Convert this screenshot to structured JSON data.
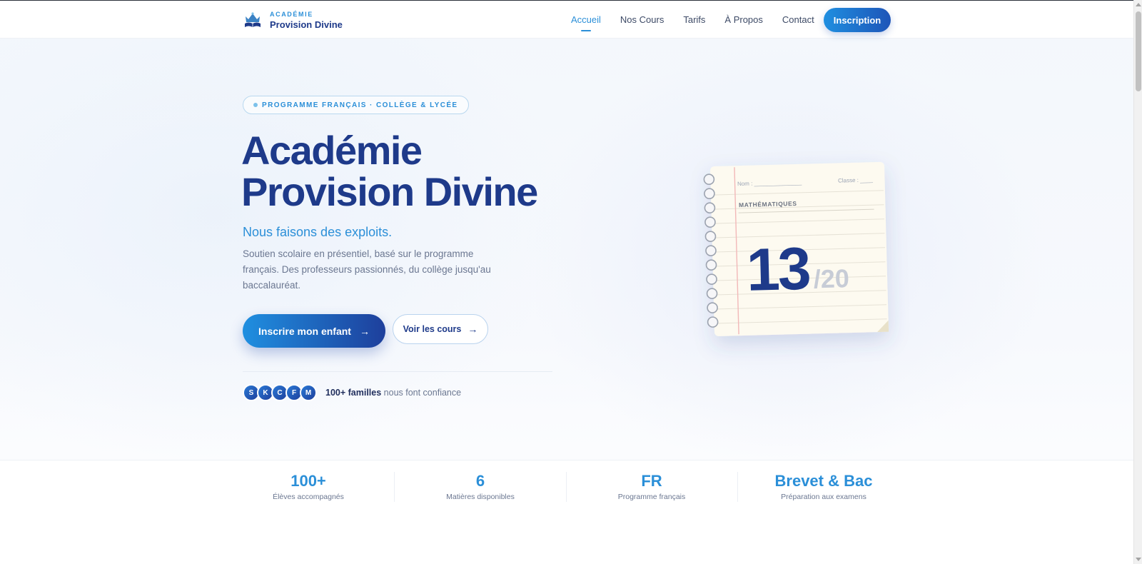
{
  "brand": {
    "top": "ACADÉMIE",
    "name": "Provision Divine",
    "logo_icon": "crown-book-logo"
  },
  "nav": {
    "links": [
      {
        "label": "Accueil",
        "active": true
      },
      {
        "label": "Nos Cours",
        "active": false
      },
      {
        "label": "Tarifs",
        "active": false
      },
      {
        "label": "À Propos",
        "active": false
      },
      {
        "label": "Contact",
        "active": false
      }
    ],
    "cta": "Inscription"
  },
  "hero": {
    "badge": "PROGRAMME FRANÇAIS · COLLÈGE & LYCÉE",
    "title_line1": "Académie",
    "title_line2": "Provision Divine",
    "tagline": "Nous faisons des exploits.",
    "description": "Soutien scolaire en présentiel, basé sur le programme français. Des professeurs passionnés, du collège jusqu'au baccalauréat.",
    "primary_cta": "Inscrire mon enfant",
    "secondary_cta": "Voir les cours",
    "avatars": [
      "S",
      "K",
      "C",
      "F",
      "M"
    ],
    "trust_strong": "100+ familles",
    "trust_rest": " nous font confiance"
  },
  "notebook": {
    "name_label": "Nom : _______________",
    "class_label": "Classe : ____",
    "subject": "MATHÉMATIQUES",
    "score": "13",
    "max": "/20"
  },
  "stats": [
    {
      "value": "100+",
      "label": "Élèves accompagnés"
    },
    {
      "value": "6",
      "label": "Matières disponibles"
    },
    {
      "value": "FR",
      "label": "Programme français"
    },
    {
      "value": "Brevet & Bac",
      "label": "Préparation aux examens"
    }
  ],
  "colors": {
    "accent": "#2b8fd8",
    "brand_dark": "#1e3a8a",
    "text_muted": "#6b7791"
  }
}
